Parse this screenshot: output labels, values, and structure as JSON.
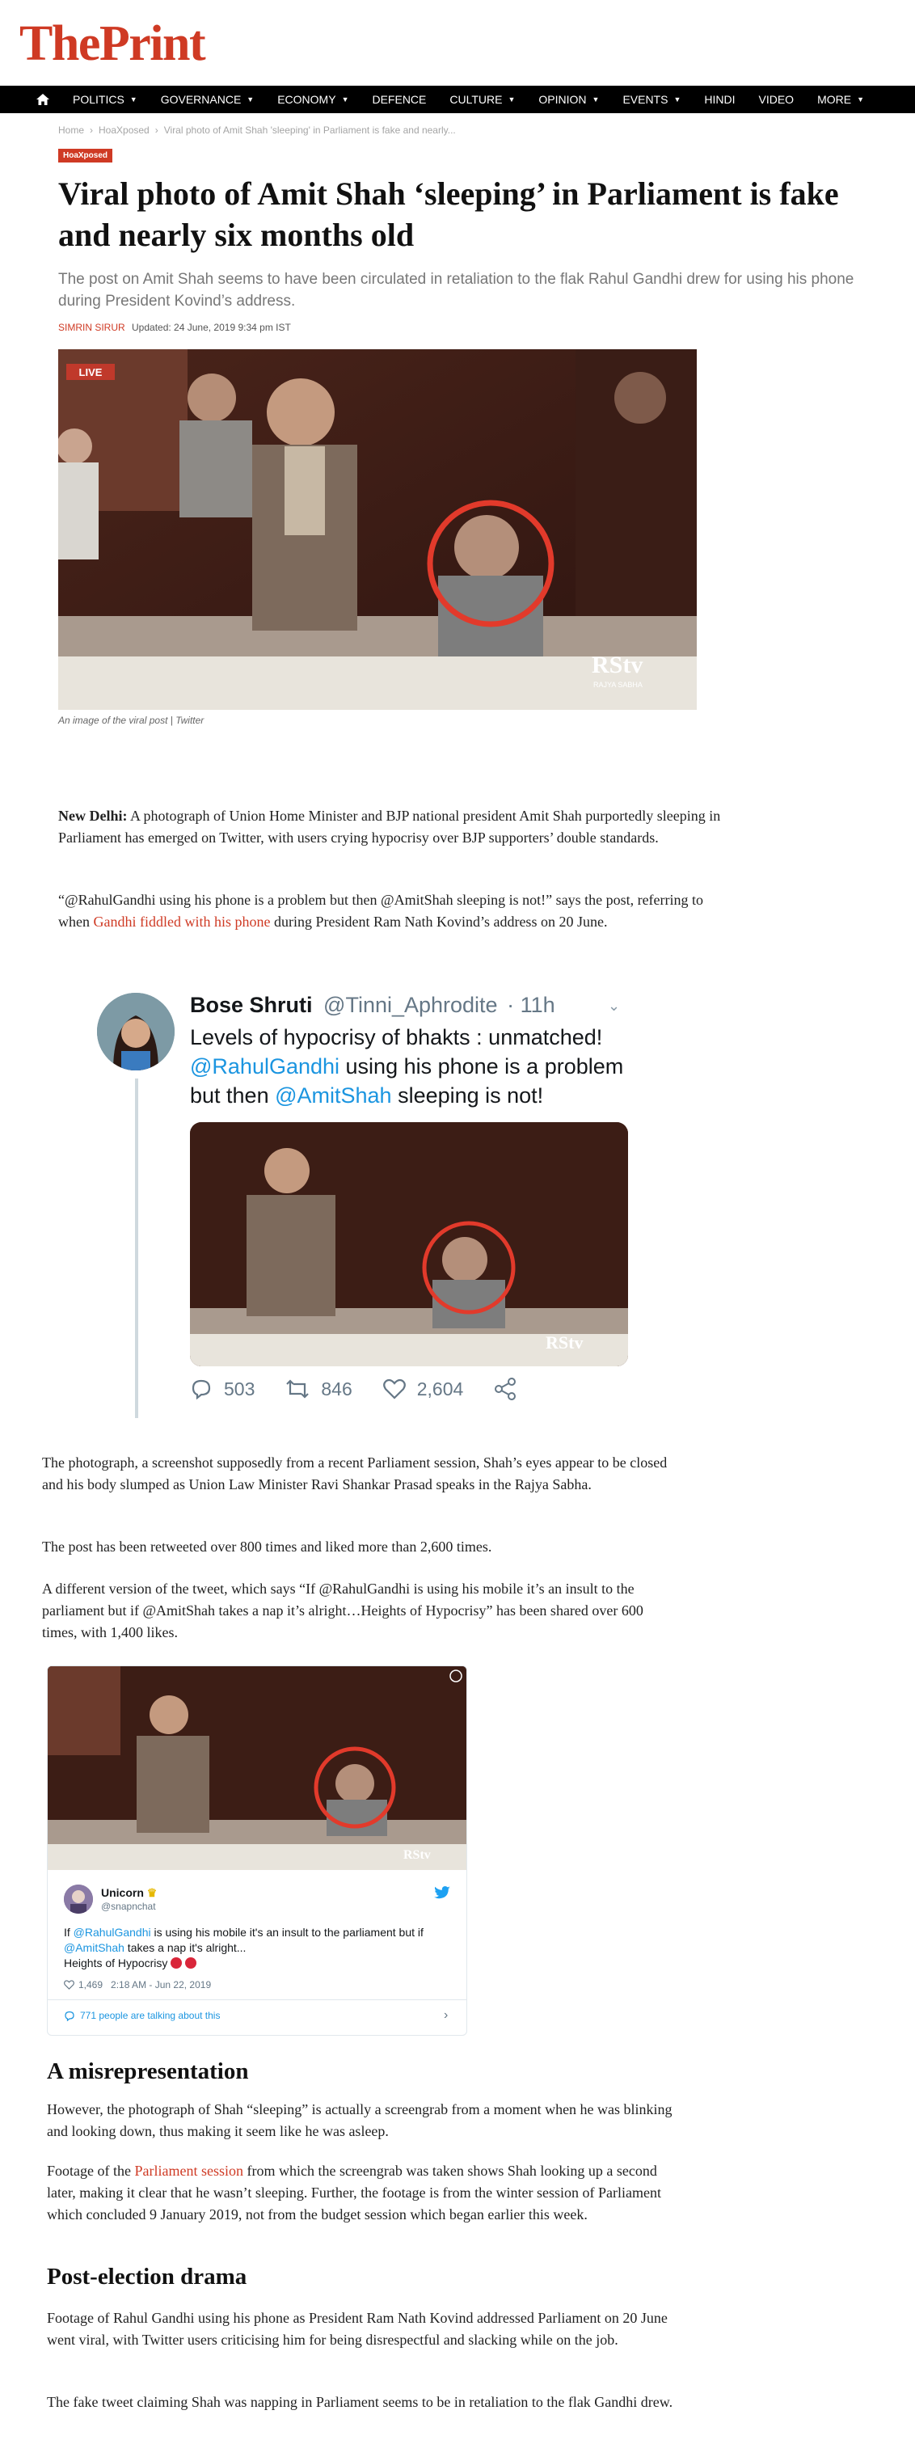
{
  "site": {
    "logo": "ThePrint"
  },
  "nav": {
    "items": [
      {
        "label": "POLITICS",
        "dropdown": true
      },
      {
        "label": "GOVERNANCE",
        "dropdown": true
      },
      {
        "label": "ECONOMY",
        "dropdown": true
      },
      {
        "label": "DEFENCE",
        "dropdown": false
      },
      {
        "label": "CULTURE",
        "dropdown": true
      },
      {
        "label": "OPINION",
        "dropdown": true
      },
      {
        "label": "EVENTS",
        "dropdown": true
      },
      {
        "label": "HINDI",
        "dropdown": false
      },
      {
        "label": "VIDEO",
        "dropdown": false
      },
      {
        "label": "MORE",
        "dropdown": true
      }
    ]
  },
  "breadcrumb": {
    "items": [
      "Home",
      "HoaXposed",
      "Viral photo of Amit Shah 'sleeping' in Parliament is fake and nearly..."
    ],
    "separator": "›"
  },
  "article": {
    "tag": "HoaXposed",
    "headline": "Viral photo of Amit Shah ‘sleeping’ in Parliament is fake and nearly six months old",
    "dek": "The post on Amit Shah seems to have been circulated in retaliation to the flak Rahul Gandhi drew for using his phone during President Kovind’s address.",
    "author": "Simrin Sirur",
    "updated": "Updated: 24 June, 2019 9:34 pm IST",
    "lead_image": {
      "live_badge": "LIVE",
      "channel": "RStv",
      "channel_sub": "RAJYA SABHA"
    },
    "caption": "An image of the viral post | Twitter",
    "p1": {
      "dateline": "New Delhi:",
      "text": " A photograph of Union Home Minister and BJP national president Amit Shah purportedly sleeping in Parliament has emerged on Twitter, with users crying hypocrisy over BJP supporters’ double standards."
    },
    "p2": {
      "before": "“@RahulGandhi using his phone is a problem but then @AmitShah sleeping is not!” says the post, referring to when ",
      "link": "Gandhi fiddled with his phone",
      "after": " during President Ram Nath Kovind’s address on 20 June."
    },
    "p3": "The photograph, a screenshot supposedly from a recent Parliament session, Shah’s eyes appear to be closed and his body slumped as Union Law Minister Ravi Shankar Prasad speaks in the Rajya Sabha.",
    "p4": "The post has been retweeted over 800 times and liked more than 2,600 times.",
    "p5": "A different version of the tweet, which says “If @RahulGandhi is using his mobile it’s an insult to the parliament but if @AmitShah takes a nap it’s alright…Heights of Hypocrisy” has been shared over 600 times, with 1,400 likes.",
    "h2_a": "A misrepresentation",
    "p6": "However, the photograph of Shah “sleeping” is actually a screengrab from a moment when he was blinking and looking down, thus making it seem like he was asleep.",
    "p7": {
      "before": "Footage of the ",
      "link": "Parliament session",
      "after": " from which the screengrab was taken shows Shah looking up a second later, making it clear that he wasn’t sleeping. Further, the footage is from the winter session of Parliament which concluded 9 January 2019, not from the budget session which began earlier this week."
    },
    "h2_b": "Post-election drama",
    "p8": "Footage of Rahul Gandhi using his phone as President Ram Nath Kovind addressed Parliament on 20 June went viral, with Twitter users criticising him for being disrespectful and slacking while on the job.",
    "p9": "The fake tweet claiming Shah was napping in Parliament seems to be in retaliation to the flak Gandhi drew."
  },
  "tweet1": {
    "name": "Bose Shruti",
    "handle": "@Tinni_Aphrodite",
    "time": "· 11h",
    "text_1": "Levels of hypocrisy of bhakts : unmatched!",
    "mention_1": "@RahulGandhi",
    "text_2": " using his phone is a problem but then ",
    "mention_2": "@AmitShah",
    "text_3": " sleeping is not!",
    "replies": "503",
    "retweets": "846",
    "likes": "2,604"
  },
  "tweet2": {
    "name": "Unicorn",
    "handle": "@snapnchat",
    "text_1": "If ",
    "mention_1": "@RahulGandhi",
    "text_2": " is using his mobile it's an insult to the parliament but if ",
    "mention_2": "@AmitShah",
    "text_3": " takes a nap it's alright...",
    "text_4": "Heights of Hypocrisy",
    "likes": "1,469",
    "time": "2:18 AM - Jun 22, 2019",
    "talking": "771 people are talking about this"
  },
  "colors": {
    "brand": "#cf3a24",
    "nav_bg": "#000000",
    "twitter_blue": "#1b95e0"
  }
}
